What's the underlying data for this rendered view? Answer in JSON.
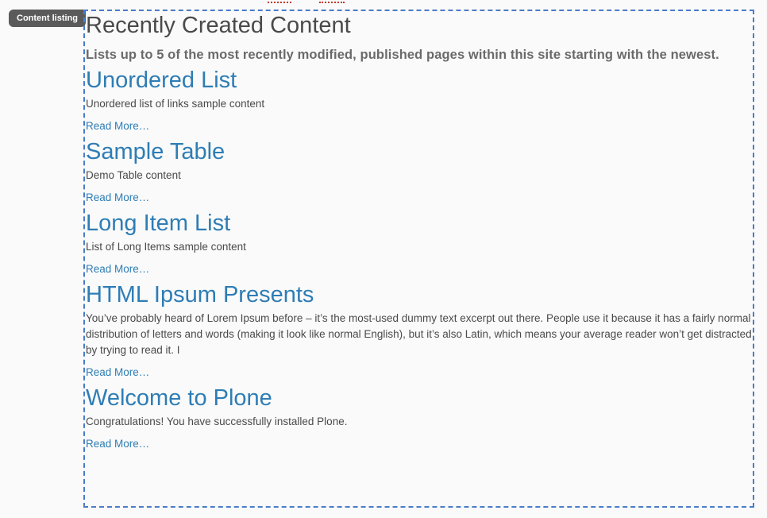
{
  "badge": {
    "label": "Content listing"
  },
  "listing": {
    "title": "Recently Created Content",
    "description": "Lists up to 5 of the most recently modified, published pages within this site starting with the newest.",
    "read_more_label": "Read More…",
    "items": [
      {
        "title": "Unordered List",
        "description": "Unordered list of links sample content"
      },
      {
        "title": "Sample Table",
        "description": "Demo Table content"
      },
      {
        "title": "Long Item List",
        "description": "List of Long Items sample content"
      },
      {
        "title": "HTML Ipsum Presents",
        "description": "You’ve probably heard of Lorem Ipsum before – it’s the most-used dummy text excerpt out there. People use it because it has a fairly normal distribution of letters and words (making it look like normal English), but it’s also Latin, which means your average reader won’t get distracted by trying to read it. I"
      },
      {
        "title": "Welcome to Plone",
        "description": "Congratulations! You have successfully installed Plone."
      }
    ]
  },
  "colors": {
    "link": "#2e7db5",
    "tile_border": "#4a7cc7",
    "badge_bg": "#5a5a5a",
    "background": "#fafafa"
  }
}
